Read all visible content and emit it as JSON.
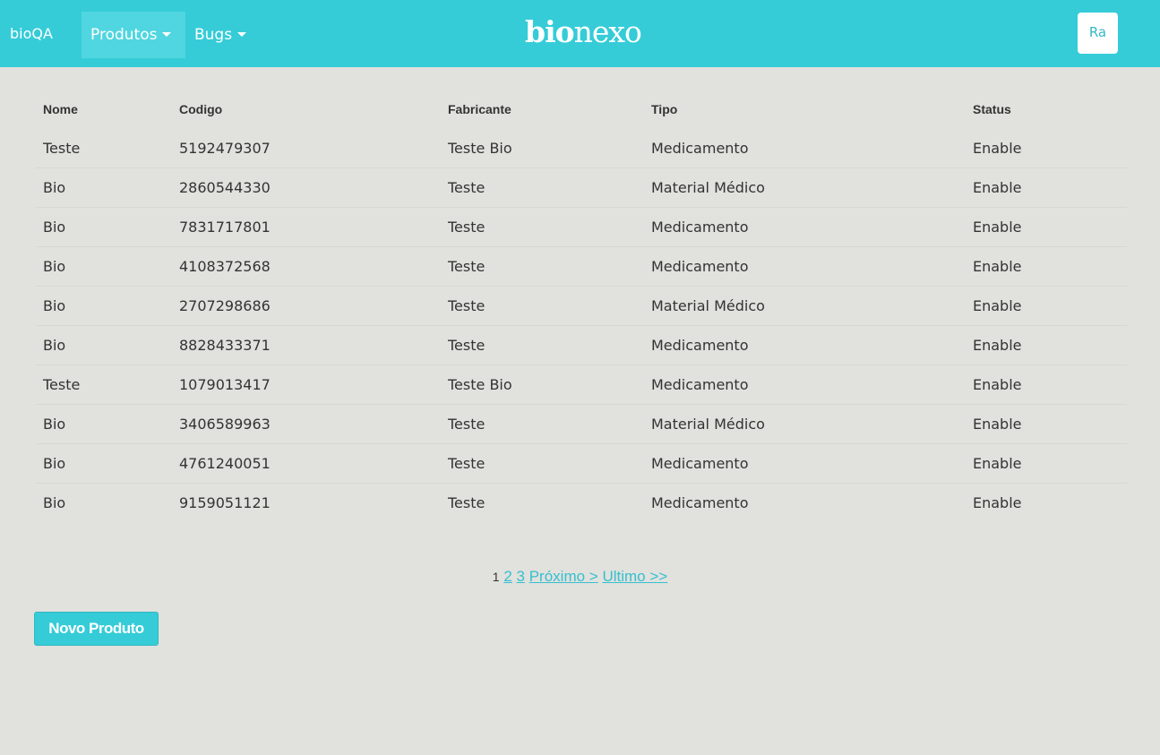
{
  "nav": {
    "brand": "bioQA",
    "produtos": "Produtos",
    "bugs": "Bugs",
    "logo_bold": "bio",
    "logo_light": "nexo",
    "user": "Ra"
  },
  "table": {
    "headers": [
      "Nome",
      "Codigo",
      "Fabricante",
      "Tipo",
      "Status"
    ],
    "rows": [
      [
        "Teste",
        "5192479307",
        "Teste Bio",
        "Medicamento",
        "Enable"
      ],
      [
        "Bio",
        "2860544330",
        "Teste",
        "Material Médico",
        "Enable"
      ],
      [
        "Bio",
        "7831717801",
        "Teste",
        "Medicamento",
        "Enable"
      ],
      [
        "Bio",
        "4108372568",
        "Teste",
        "Medicamento",
        "Enable"
      ],
      [
        "Bio",
        "2707298686",
        "Teste",
        "Material Médico",
        "Enable"
      ],
      [
        "Bio",
        "8828433371",
        "Teste",
        "Medicamento",
        "Enable"
      ],
      [
        "Teste",
        "1079013417",
        "Teste Bio",
        "Medicamento",
        "Enable"
      ],
      [
        "Bio",
        "3406589963",
        "Teste",
        "Material Médico",
        "Enable"
      ],
      [
        "Bio",
        "4761240051",
        "Teste",
        "Medicamento",
        "Enable"
      ],
      [
        "Bio",
        "9159051121",
        "Teste",
        "Medicamento",
        "Enable"
      ]
    ]
  },
  "pagination": {
    "current": "1",
    "pages": [
      "2",
      "3"
    ],
    "next": "Próximo >",
    "last": "Ultimo >>"
  },
  "actions": {
    "new_product": "Novo Produto"
  },
  "colors": {
    "navbar": "#35ccd8",
    "background": "#e1e1dd",
    "link": "#35c0cf"
  }
}
